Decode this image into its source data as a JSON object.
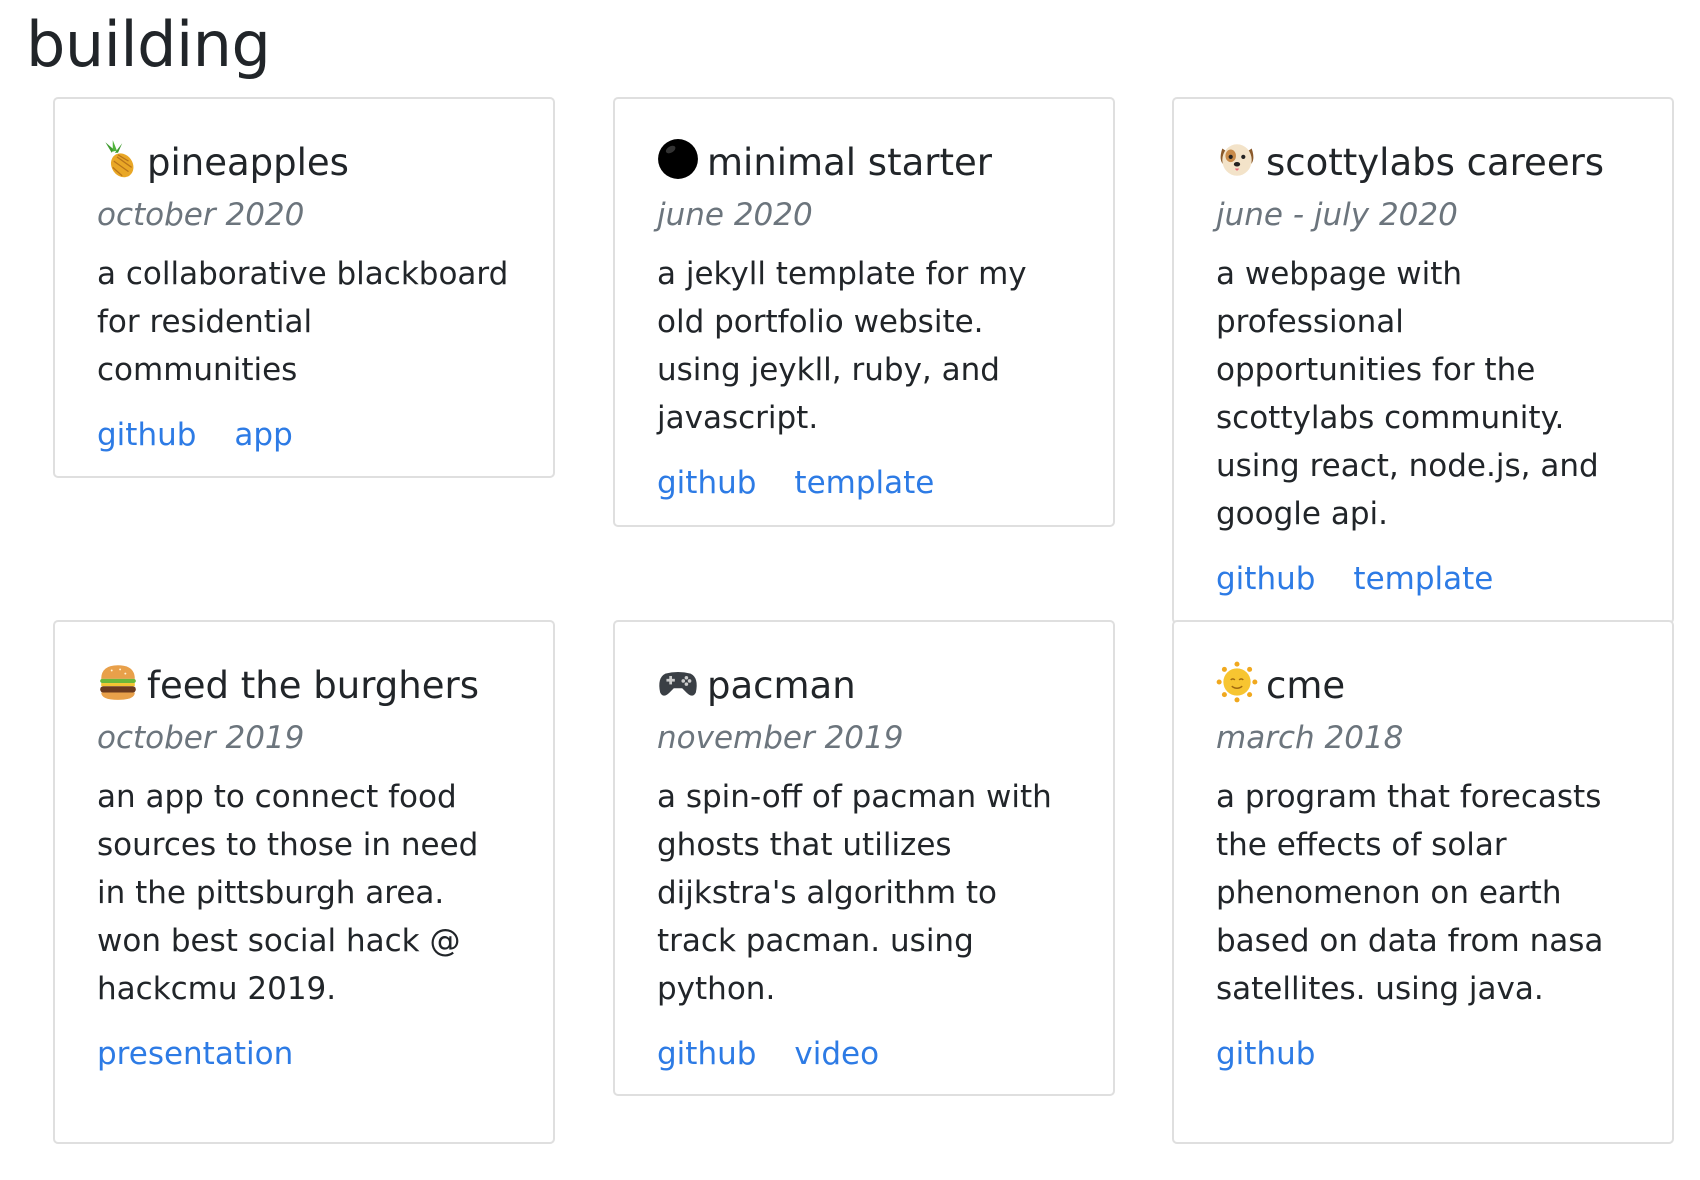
{
  "page": {
    "title": "building"
  },
  "projects": [
    {
      "icon": "pineapple-icon",
      "title": "pineapples",
      "date": "october 2020",
      "description": "a collaborative blackboard for residential communities",
      "links": [
        "github",
        "app"
      ]
    },
    {
      "icon": "black-circle-icon",
      "title": "minimal starter",
      "date": "june 2020",
      "description": "a jekyll template for my old portfolio website. using jeykll, ruby, and javascript.",
      "links": [
        "github",
        "template"
      ]
    },
    {
      "icon": "dog-face-icon",
      "title": "scottylabs careers",
      "date": "june - july 2020",
      "description": "a webpage with professional opportunities for the scottylabs community. using react, node.js, and google api.",
      "links": [
        "github",
        "template"
      ]
    },
    {
      "icon": "hamburger-icon",
      "title": "feed the burghers",
      "date": "october 2019",
      "description": "an app to connect food sources to those in need in the pittsburgh area. won best social hack @ hackcmu 2019.",
      "links": [
        "presentation"
      ]
    },
    {
      "icon": "game-controller-icon",
      "title": "pacman",
      "date": "november 2019",
      "description": "a spin-off of pacman with ghosts that utilizes dijkstra's algorithm to track pacman. using python.",
      "links": [
        "github",
        "video"
      ]
    },
    {
      "icon": "sun-with-face-icon",
      "title": "cme",
      "date": "march 2018",
      "description": "a program that forecasts the effects of solar phenomenon on earth based on data from nasa satellites. using java.",
      "links": [
        "github"
      ]
    }
  ],
  "colors": {
    "link": "#2d7be5",
    "muted": "#6c757d",
    "text": "#212529",
    "border": "#dfdfdf"
  }
}
